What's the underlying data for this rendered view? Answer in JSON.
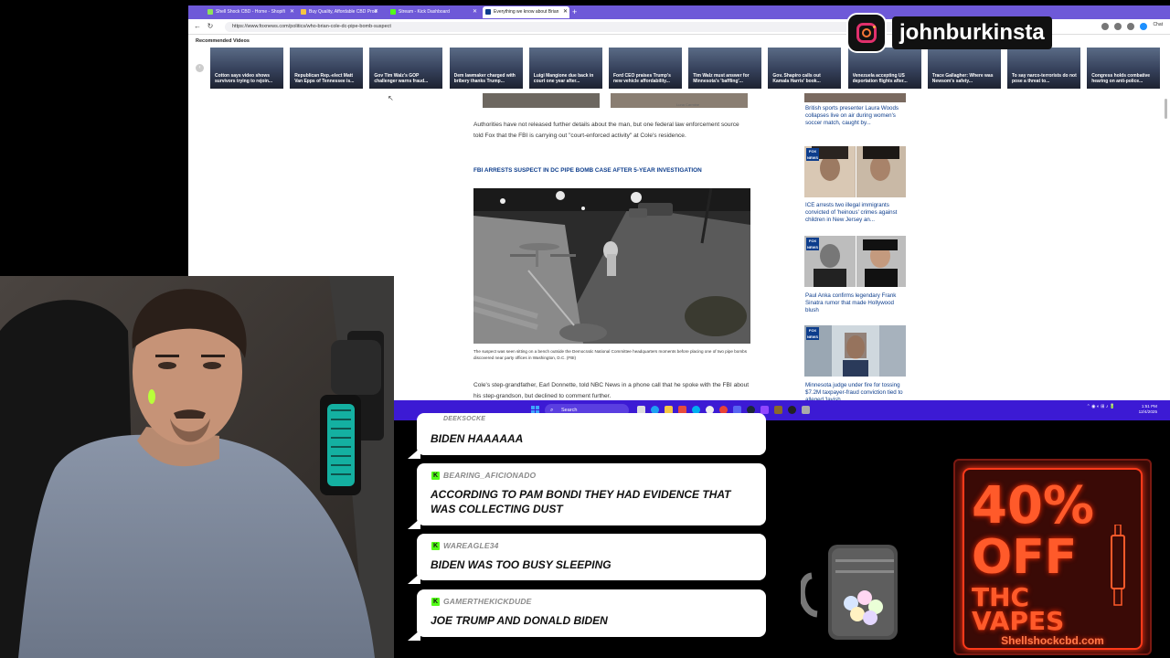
{
  "browser": {
    "tabs": [
      {
        "title": "Shell Shock CBD - Home - Shopifi",
        "color": "#8fe35a"
      },
      {
        "title": "Buy Quality, Affordable CBD Prod",
        "color": "#f5c542"
      },
      {
        "title": "Stream - Kick Dashboard",
        "color": "#53fc18"
      },
      {
        "title": "Everything we know about Brian",
        "color": "#0d3d8c"
      }
    ],
    "new_tab": "+",
    "url": "https://www.foxnews.com/politics/who-brian-cole-dc-pipe-bomb-suspect",
    "chat_label": "Chat"
  },
  "recommended": {
    "title": "Recommended Videos",
    "videos": [
      "Cotton says video shows survivors trying to rejoin...",
      "Republican Rep.-elect Matt Van Epps of Tennessee is...",
      "Gov Tim Walz's GOP challenger warns fraud...",
      "Dem lawmaker charged with bribery thanks Trump...",
      "Luigi Mangione due back in court one year after...",
      "Ford CEO praises Trump's new vehicle affordability...",
      "Tim Walz must answer for Minnesota's 'baffling'...",
      "Gov. Shapiro calls out Kamala Harris' book...",
      "Venezuela accepting US deportation flights after...",
      "Trace Gallagher: Where was Newsom's safety...",
      "To say narco-terrorists do not pose a threat to...",
      "Congress holds combative hearing on anti-police..."
    ]
  },
  "article": {
    "top_caption": "Luna Carmine",
    "para1": "Authorities have not released further details about the man, but one federal law enforcement source told Fox that the FBI is carrying out \"court-enforced activity\" at Cole's residence.",
    "link": "FBI ARRESTS SUSPECT IN DC PIPE BOMB CASE AFTER 5-YEAR INVESTIGATION",
    "photo_caption": "The suspect was seen sitting on a bench outside the Democratic National Committee headquarters moments before placing one of two pipe bombs discovered near party offices in Washington, D.C. (FBI)",
    "para2": "Cole's step-grandfather, Earl Donnette, told NBC News in a phone call that he spoke with the FBI about his step-grandson, but declined to comment further."
  },
  "sidebar": {
    "badge": "FOX NEWS",
    "items": [
      "British sports presenter Laura Woods collapses live on air during women's soccer match, caught by...",
      "ICE arrests two illegal immigrants convicted of 'heinous' crimes against children in New Jersey an...",
      "Paul Anka confirms legendary Frank Sinatra rumor that made Hollywood blush",
      "Minnesota judge under fire for tossing $7.2M taxpayer-fraud conviction tied to alleged 'lavish..."
    ]
  },
  "instagram": {
    "handle": "johnburkinsta"
  },
  "taskbar": {
    "search": "Search",
    "time": "1:51 PM",
    "date": "12/4/2025"
  },
  "chat": [
    {
      "user": "DEEKSOCKE",
      "message": "BIDEN HAAAAAA"
    },
    {
      "user": "BEARING_AFICIONADO",
      "message": "ACCORDING TO PAM BONDI THEY HAD EVIDENCE THAT WAS COLLECTING DUST"
    },
    {
      "user": "WAREAGLE34",
      "message": "BIDEN WAS TOO BUSY SLEEPING"
    },
    {
      "user": "GAMERTHEKICKDUDE",
      "message": "JOE TRUMP AND DONALD BIDEN"
    }
  ],
  "ad": {
    "line1": "40%",
    "line2": "OFF",
    "line3": "THC",
    "line4": "VAPES",
    "site": "Shellshockcbd.com"
  },
  "colors": {
    "tabbar": "#6e59d8",
    "taskbar": "#3c1ad4",
    "kick_green": "#53fc18",
    "fox_link": "#0d3d8c",
    "ad_neon": "#ff3a1a"
  }
}
